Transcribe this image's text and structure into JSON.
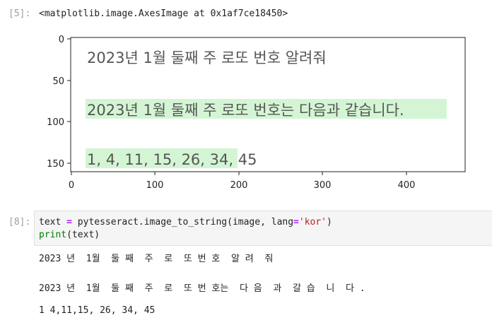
{
  "cell_output_1": {
    "prompt": "[5]:",
    "repr": "<matplotlib.image.AxesImage at 0x1af7ce18450>"
  },
  "plot": {
    "line1": "2023년 1월 둘째 주 로또 번호 알려줘",
    "line2": "2023년 1월 둘째 주 로또 번호는 다음과 같습니다.",
    "line3": "1, 4, 11, 15, 26, 34, 45",
    "highlight_color": "#d4f5d4",
    "x_ticks": [
      "0",
      "100",
      "200",
      "300",
      "400"
    ],
    "y_ticks": [
      "0",
      "50",
      "100",
      "150"
    ],
    "x_range": [
      0,
      460
    ],
    "y_range": [
      0,
      160
    ]
  },
  "code_cell": {
    "prompt": "[8]:",
    "line1": {
      "var": "text",
      "op": "=",
      "module": "pytesseract",
      "func": "image_to_string",
      "args_pre": "(image, lang",
      "op2": "=",
      "str": "'kor'",
      "args_post": ")"
    },
    "line2": {
      "func": "print",
      "args": "(text)"
    }
  },
  "output": {
    "line1": "2023 년  1월  둘 째  주  로  또 번 호  알 려  줘",
    "line2": "2023 년  1월  둘 째  주  로  또 번 호는  다 음  과  갈 습  니  다 .",
    "line3": "1 4,11,15, 26, 34, 45"
  }
}
